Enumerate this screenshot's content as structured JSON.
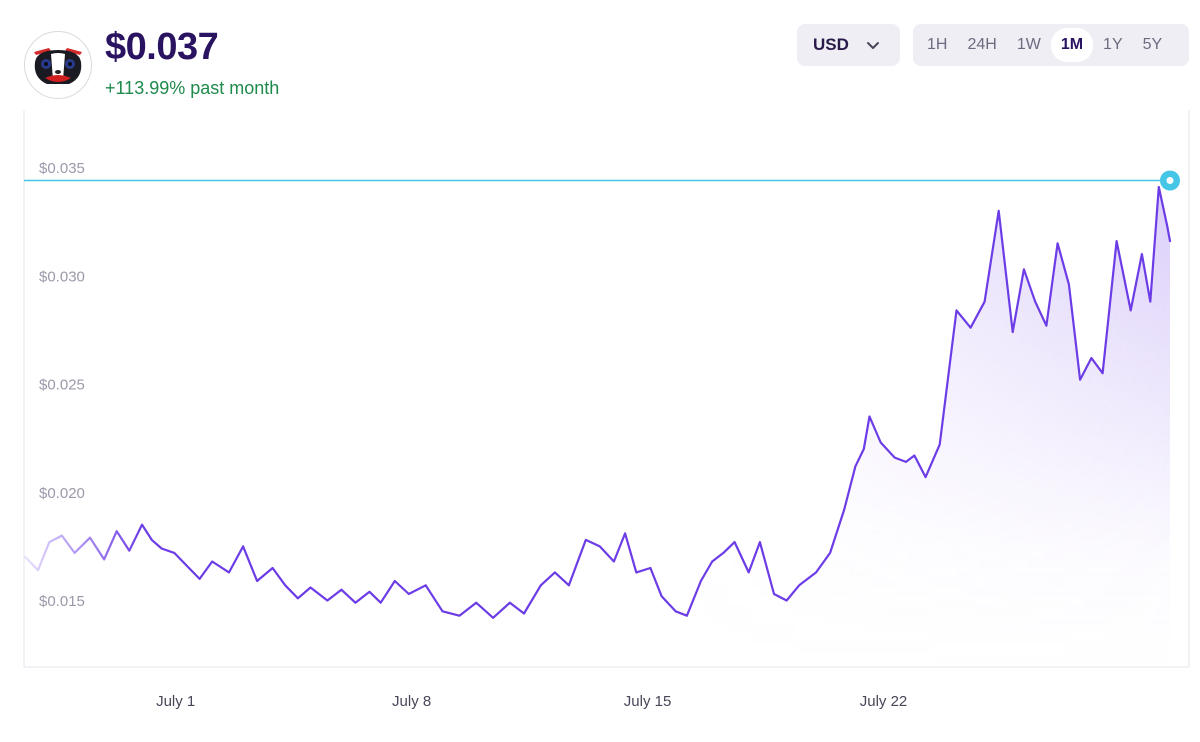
{
  "header": {
    "price": "$0.037",
    "change": "+113.99% past month"
  },
  "avatar": {
    "icon": "clown-cat-avatar-icon"
  },
  "currency": {
    "label": "USD",
    "icon": "chevron-down-icon"
  },
  "ranges": [
    {
      "label": "1H",
      "active": false
    },
    {
      "label": "24H",
      "active": false
    },
    {
      "label": "1W",
      "active": false
    },
    {
      "label": "1M",
      "active": true
    },
    {
      "label": "1Y",
      "active": false
    },
    {
      "label": "5Y",
      "active": false
    }
  ],
  "colors": {
    "line": "#6c3ce6",
    "area": "#a98bf2",
    "reference": "#45c6e6",
    "price_text": "#2a1360",
    "change_text": "#1f8a4c"
  },
  "chart_data": {
    "type": "line",
    "x_axis": "date",
    "xlim": [
      "2024-06-26T12:00",
      "2024-07-30T12:00"
    ],
    "ylim": [
      0.0125,
      0.0375
    ],
    "yticks": [
      {
        "value": 0.035,
        "label": "$0.035"
      },
      {
        "value": 0.03,
        "label": "$0.030"
      },
      {
        "value": 0.025,
        "label": "$0.025"
      },
      {
        "value": 0.02,
        "label": "$0.020"
      },
      {
        "value": 0.015,
        "label": "$0.015"
      }
    ],
    "xticks": [
      {
        "value": "2024-07-01T00:00",
        "label": "July 1"
      },
      {
        "value": "2024-07-08T00:00",
        "label": "July 8"
      },
      {
        "value": "2024-07-15T00:00",
        "label": "July 15"
      },
      {
        "value": "2024-07-22T00:00",
        "label": "July 22"
      }
    ],
    "reference_line": 0.0347,
    "grid": false,
    "series": [
      {
        "x": [
          "2024-06-26T13:00",
          "2024-06-26T22:00",
          "2024-06-27T06:00",
          "2024-06-27T15:00",
          "2024-06-28T00:00",
          "2024-06-28T11:00",
          "2024-06-28T21:00",
          "2024-06-29T06:00",
          "2024-06-29T15:00",
          "2024-06-30T00:00",
          "2024-06-30T07:00",
          "2024-06-30T14:00",
          "2024-06-30T23:00",
          "2024-07-01T08:00",
          "2024-07-01T17:00",
          "2024-07-02T02:00",
          "2024-07-02T14:00",
          "2024-07-03T00:00",
          "2024-07-03T10:00",
          "2024-07-03T21:00",
          "2024-07-04T06:00",
          "2024-07-04T15:00",
          "2024-07-05T00:00",
          "2024-07-05T12:00",
          "2024-07-05T22:00",
          "2024-07-06T08:00",
          "2024-07-06T18:00",
          "2024-07-07T02:00",
          "2024-07-07T12:00",
          "2024-07-07T22:00",
          "2024-07-08T10:00",
          "2024-07-08T22:00",
          "2024-07-09T10:00",
          "2024-07-09T22:00",
          "2024-07-10T10:00",
          "2024-07-10T22:00",
          "2024-07-11T08:00",
          "2024-07-11T20:00",
          "2024-07-12T06:00",
          "2024-07-12T16:00",
          "2024-07-13T04:00",
          "2024-07-13T14:00",
          "2024-07-14T00:00",
          "2024-07-14T08:00",
          "2024-07-14T16:00",
          "2024-07-15T02:00",
          "2024-07-15T10:00",
          "2024-07-15T20:00",
          "2024-07-16T04:00",
          "2024-07-16T14:00",
          "2024-07-16T22:00",
          "2024-07-17T06:00",
          "2024-07-17T14:00",
          "2024-07-18T00:00",
          "2024-07-18T08:00",
          "2024-07-18T18:00",
          "2024-07-19T03:00",
          "2024-07-19T12:00",
          "2024-07-20T00:00",
          "2024-07-20T10:00",
          "2024-07-20T20:00",
          "2024-07-21T04:00",
          "2024-07-21T10:00",
          "2024-07-21T14:00",
          "2024-07-21T22:00",
          "2024-07-22T08:00",
          "2024-07-22T16:00",
          "2024-07-22T22:00",
          "2024-07-23T06:00",
          "2024-07-23T16:00",
          "2024-07-24T04:00",
          "2024-07-24T14:00",
          "2024-07-25T00:00",
          "2024-07-25T10:00",
          "2024-07-25T20:00",
          "2024-07-26T04:00",
          "2024-07-26T12:00",
          "2024-07-26T20:00",
          "2024-07-27T04:00",
          "2024-07-27T12:00",
          "2024-07-27T20:00",
          "2024-07-28T04:00",
          "2024-07-28T12:00",
          "2024-07-28T22:00",
          "2024-07-29T08:00",
          "2024-07-29T16:00",
          "2024-07-29T22:00",
          "2024-07-30T04:00",
          "2024-07-30T10:00",
          "2024-07-30T12:00"
        ],
        "values": [
          0.0173,
          0.0167,
          0.018,
          0.0183,
          0.0175,
          0.0182,
          0.0172,
          0.0185,
          0.0176,
          0.0188,
          0.0181,
          0.0177,
          0.0175,
          0.0169,
          0.0163,
          0.0171,
          0.0166,
          0.0178,
          0.0162,
          0.0168,
          0.016,
          0.0154,
          0.0159,
          0.0153,
          0.0158,
          0.0152,
          0.0157,
          0.0152,
          0.0162,
          0.0156,
          0.016,
          0.0148,
          0.0146,
          0.0152,
          0.0145,
          0.0152,
          0.0147,
          0.016,
          0.0166,
          0.016,
          0.0181,
          0.0178,
          0.0171,
          0.0184,
          0.0166,
          0.0168,
          0.0155,
          0.0148,
          0.0146,
          0.0162,
          0.0171,
          0.0175,
          0.018,
          0.0166,
          0.018,
          0.0156,
          0.0153,
          0.016,
          0.0166,
          0.0175,
          0.0195,
          0.0215,
          0.0223,
          0.0238,
          0.0226,
          0.0219,
          0.0217,
          0.022,
          0.021,
          0.0225,
          0.0287,
          0.0279,
          0.0291,
          0.0333,
          0.0277,
          0.0306,
          0.0291,
          0.028,
          0.0318,
          0.0299,
          0.0255,
          0.0265,
          0.0258,
          0.0319,
          0.0287,
          0.0313,
          0.0291,
          0.0344,
          0.0326,
          0.0319
        ]
      }
    ]
  }
}
